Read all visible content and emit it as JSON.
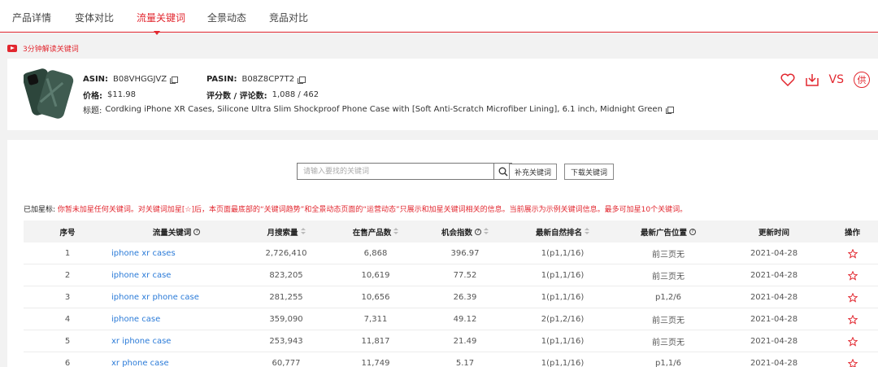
{
  "tabs": [
    {
      "label": "产品详情"
    },
    {
      "label": "变体对比"
    },
    {
      "label": "流量关键词"
    },
    {
      "label": "全景动态"
    },
    {
      "label": "竞品对比"
    }
  ],
  "video_link": "3分钟解读关键词",
  "product": {
    "asin_label": "ASIN:",
    "asin": "B08VHGGJVZ",
    "pasin_label": "PASIN:",
    "pasin": "B08Z8CP7T2",
    "price_label": "价格:",
    "price": "$11.98",
    "rating_label": "评分数 / 评论数:",
    "rating": "1,088 / 462",
    "title_label": "标题:",
    "title": "Cordking iPhone XR Cases, Silicone Ultra Slim Shockproof Phone Case with [Soft Anti-Scratch Microfiber Lining], 6.1 inch, Midnight Green",
    "vs_label": "VS",
    "supplier_label": "供"
  },
  "search": {
    "placeholder": "请输入要找的关键词",
    "add_label": "补充关键词",
    "download_label": "下载关键词"
  },
  "notice": {
    "label": "已加星标:",
    "text": "你暂未加星任何关键词。对关键词加星[☆]后，本页面最底部的“关键词趋势”和全景动态页面的“运营动态”只展示和加星关键词相关的信息。当前展示为示例关键词信息。最多可加星10个关键词。"
  },
  "table": {
    "headers": {
      "index": "序号",
      "keyword": "流量关键词",
      "volume": "月搜索量",
      "products": "在售产品数",
      "opportunity": "机会指数",
      "natural_rank": "最新自然排名",
      "ad_position": "最新广告位置",
      "updated": "更新时间",
      "action": "操作"
    },
    "rows": [
      {
        "index": "1",
        "keyword": "iphone xr cases",
        "volume": "2,726,410",
        "products": "6,868",
        "opportunity": "396.97",
        "natural_rank": "1(p1,1/16)",
        "ad_position": "前三页无",
        "updated": "2021-04-28",
        "star": "☆"
      },
      {
        "index": "2",
        "keyword": "iphone xr case",
        "volume": "823,205",
        "products": "10,619",
        "opportunity": "77.52",
        "natural_rank": "1(p1,1/16)",
        "ad_position": "前三页无",
        "updated": "2021-04-28",
        "star": "☆"
      },
      {
        "index": "3",
        "keyword": "iphone xr phone case",
        "volume": "281,255",
        "products": "10,656",
        "opportunity": "26.39",
        "natural_rank": "1(p1,1/16)",
        "ad_position": "p1,2/6",
        "updated": "2021-04-28",
        "star": "☆"
      },
      {
        "index": "4",
        "keyword": "iphone case",
        "volume": "359,090",
        "products": "7,311",
        "opportunity": "49.12",
        "natural_rank": "2(p1,2/16)",
        "ad_position": "前三页无",
        "updated": "2021-04-28",
        "star": "☆"
      },
      {
        "index": "5",
        "keyword": "xr iphone case",
        "volume": "253,943",
        "products": "11,817",
        "opportunity": "21.49",
        "natural_rank": "1(p1,1/16)",
        "ad_position": "前三页无",
        "updated": "2021-04-28",
        "star": "☆"
      },
      {
        "index": "6",
        "keyword": "xr phone case",
        "volume": "60,777",
        "products": "11,749",
        "opportunity": "5.17",
        "natural_rank": "1(p1,1/16)",
        "ad_position": "p1,1/6",
        "updated": "2021-04-28",
        "star": "☆"
      }
    ]
  },
  "colors": {
    "accent": "#e2272f",
    "link": "#2b7bd8",
    "case": "#3f5b50"
  }
}
